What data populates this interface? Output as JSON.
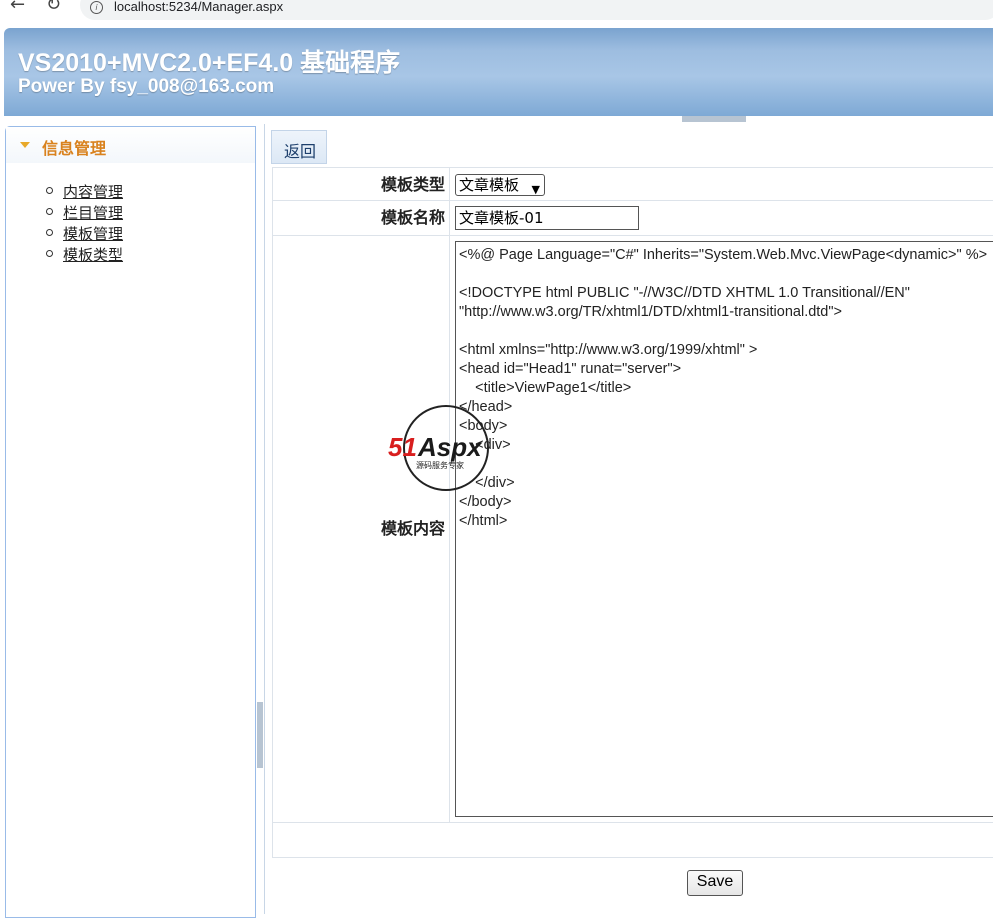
{
  "browser": {
    "url": "localhost:5234/Manager.aspx",
    "info_icon": "i"
  },
  "header": {
    "title": "VS2010+MVC2.0+EF4.0 基础程序",
    "subtitle": "Power By fsy_008@163.com"
  },
  "sidebar": {
    "title": "信息管理",
    "items": [
      {
        "label": "内容管理"
      },
      {
        "label": "栏目管理"
      },
      {
        "label": "模板管理"
      },
      {
        "label": "模板类型"
      }
    ]
  },
  "toolbar": {
    "back_label": "返回"
  },
  "form": {
    "type_label": "模板类型",
    "type_value": "文章模板",
    "name_label": "模板名称",
    "name_value": "文章模板-01",
    "content_label": "模板内容",
    "content_lines": [
      "<%@ Page Language=\"C#\" Inherits=\"System.Web.Mvc.ViewPage<dynamic>\" %>",
      "",
      "<!DOCTYPE html PUBLIC \"-//W3C//DTD XHTML 1.0 Transitional//EN\"",
      "\"http://www.w3.org/TR/xhtml1/DTD/xhtml1-transitional.dtd\">",
      "",
      "<html xmlns=\"http://www.w3.org/1999/xhtml\" >",
      "<head id=\"Head1\" runat=\"server\">",
      "    <title>ViewPage1</title>",
      "</head>",
      "<body>",
      "    <div>",
      "",
      "    </div>",
      "</body>",
      "</html>"
    ],
    "save_label": "Save"
  },
  "watermark": {
    "brand": "51Aspx",
    "tagline": "源码服务专家"
  },
  "colors": {
    "header_blue": "#8fb3da",
    "sidebar_title": "#d9821e",
    "link": "#222222"
  }
}
